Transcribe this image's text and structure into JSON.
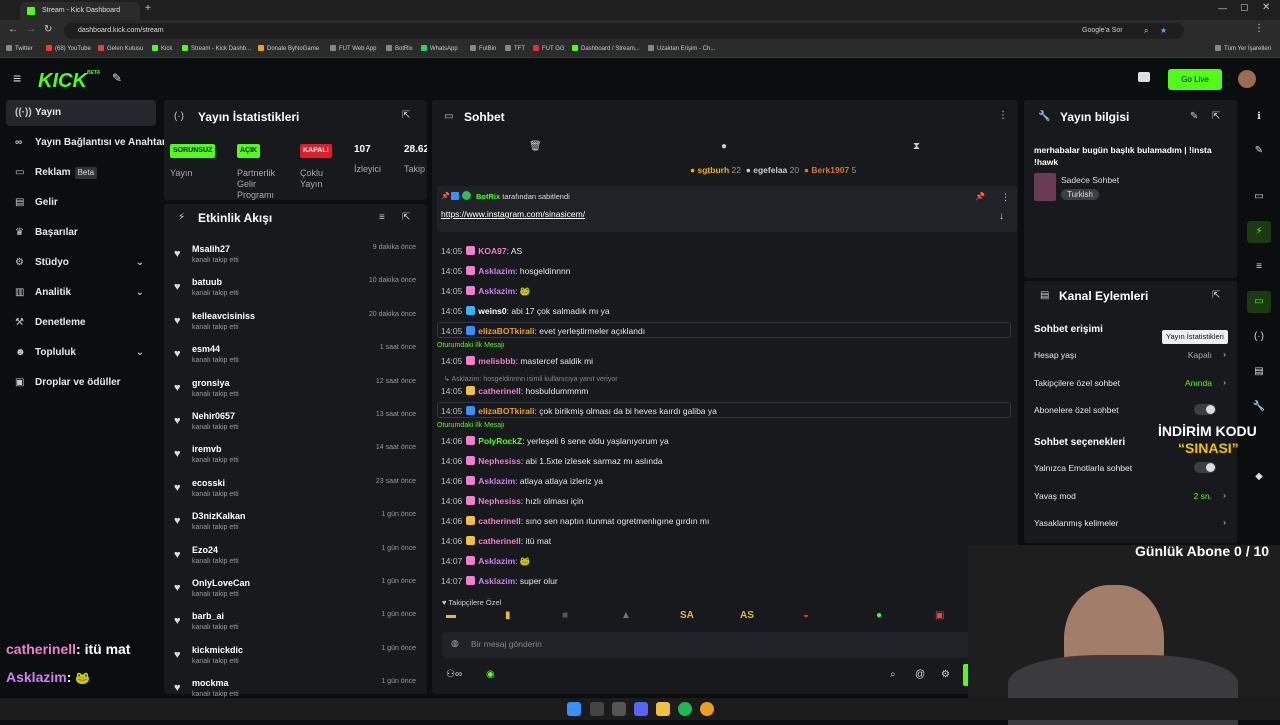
{
  "browser": {
    "tab_title": "Stream - Kick Dashboard",
    "url": "dashboard.kick.com/stream",
    "google_label": "Google'a Sor",
    "bookmarks": [
      "Twitter",
      "(68) YouTube",
      "Gelen Kutusu",
      "Kick",
      "Stream - Kick Dashb...",
      "Donate ByNoGame",
      "FUT Web App",
      "BotRix",
      "WhatsApp",
      "FutBin",
      "TFT",
      "FUT GG",
      "Dashboard / Stream...",
      "Uzaktan Erişim - Ch..."
    ],
    "all_bookmarks": "Tüm Yer İşaretleri"
  },
  "header": {
    "logo": "KICK",
    "logo_sup": "BETA",
    "go_live": "Go Live"
  },
  "nav": {
    "items": [
      {
        "label": "Yayın",
        "icon": "((•))"
      },
      {
        "label": "Yayın Bağlantısı ve Anahtarı",
        "icon": "🔗"
      },
      {
        "label": "Reklam",
        "icon": "▭",
        "badge": "Beta"
      },
      {
        "label": "Gelir",
        "icon": "▭"
      },
      {
        "label": "Başarılar",
        "icon": "🏆"
      },
      {
        "label": "Stüdyo",
        "icon": "⚙"
      },
      {
        "label": "Analitik",
        "icon": "▤"
      },
      {
        "label": "Denetleme",
        "icon": "🔨"
      },
      {
        "label": "Topluluk",
        "icon": "👥"
      },
      {
        "label": "Droplar ve ödüller",
        "icon": "🎁"
      }
    ]
  },
  "stats": {
    "title": "Yayın İstatistikleri",
    "items": [
      {
        "pill": "SORUNSUZ",
        "label": "Yayın"
      },
      {
        "pill": "AÇIK",
        "label": "Partnerlik Gelir Programı"
      },
      {
        "pill": "KAPALI",
        "label": "Çoklu Yayın"
      },
      {
        "num": "107",
        "label": "İzleyici"
      },
      {
        "num": "28.62",
        "label": "Takip"
      }
    ]
  },
  "activity": {
    "title": "Etkinlik Akışı",
    "action": "kanalı takip etti",
    "items": [
      {
        "name": "Msalih27",
        "time": "9 dakika önce"
      },
      {
        "name": "batuub",
        "time": "10 dakika önce"
      },
      {
        "name": "kelleavcisiniss",
        "time": "20 dakika önce"
      },
      {
        "name": "esm44",
        "time": "1 saat önce"
      },
      {
        "name": "gronsiya",
        "time": "12 saat önce"
      },
      {
        "name": "Nehir0657",
        "time": "13 saat önce"
      },
      {
        "name": "iremvb",
        "time": "14 saat önce"
      },
      {
        "name": "ecosski",
        "time": "23 saat önce"
      },
      {
        "name": "D3nizKalkan",
        "time": "1 gün önce"
      },
      {
        "name": "Ezo24",
        "time": "1 gün önce"
      },
      {
        "name": "OnlyLoveCan",
        "time": "1 gün önce"
      },
      {
        "name": "barb_ai",
        "time": "1 gün önce"
      },
      {
        "name": "kickmickdic",
        "time": "1 gün önce"
      },
      {
        "name": "mockma",
        "time": "1 gün önce"
      }
    ]
  },
  "chat": {
    "title": "Sohbet",
    "top_gifters": [
      {
        "name": "sgtburh",
        "count": "22"
      },
      {
        "name": "egefelaa",
        "count": "20"
      },
      {
        "name": "Berk1907",
        "count": "5"
      }
    ],
    "pinned_by": "BotRix",
    "pinned_suffix": "tarafından sabitlendi",
    "pinned_link": "https://www.instagram.com/sinasicem/",
    "first_message_label": "Oturumdaki İlk Mesajı",
    "reply_note": "Asklazim: hosgeldinnnn isimli kullanıcıya yanıt veriyor",
    "messages": [
      {
        "time": "14:05",
        "user": "KOA97",
        "text": "AS",
        "color": "#f07fd0"
      },
      {
        "time": "14:05",
        "user": "Asklazim",
        "text": "hosgeldinnnn",
        "color": "#d07ff0"
      },
      {
        "time": "14:05",
        "user": "Asklazim",
        "text": "🐸",
        "color": "#d07ff0"
      },
      {
        "time": "14:05",
        "user": "weins0",
        "text": "abi 17 çok salmadık mı ya",
        "color": "#ffffff"
      },
      {
        "time": "14:05",
        "user": "elizaBOTkirali",
        "text": "evet yerleştirmeler açıklandı",
        "color": "#f0a020"
      },
      {
        "time": "14:05",
        "user": "melisbbb",
        "text": "mastercef saldik mi",
        "color": "#f07fd0"
      },
      {
        "time": "14:05",
        "user": "catherinell",
        "text": "hosbuldummmm",
        "color": "#f07fd0"
      },
      {
        "time": "14:05",
        "user": "elizaBOTkirali",
        "text": "çok birikmiş olması da bi heves kaırdı galiba ya",
        "color": "#f0a020"
      },
      {
        "time": "14:06",
        "user": "PolyRockZ",
        "text": "yerleşeli 6 sene oldu yaşlanıyorum ya",
        "color": "#53fc18"
      },
      {
        "time": "14:06",
        "user": "Nephesiss",
        "text": "abi 1.5xte izlesek sarmaz mı aslında",
        "color": "#f07fd0"
      },
      {
        "time": "14:06",
        "user": "Asklazim",
        "text": "atlaya atlaya izleriz ya",
        "color": "#d07ff0"
      },
      {
        "time": "14:06",
        "user": "Nephesiss",
        "text": "hızlı olması için",
        "color": "#f07fd0"
      },
      {
        "time": "14:06",
        "user": "catherinell",
        "text": "sıno sen naptın ıtunmat ogretmenlıgıne gırdın mı",
        "color": "#f07fd0"
      },
      {
        "time": "14:06",
        "user": "catherinell",
        "text": "itü mat",
        "color": "#f07fd0"
      },
      {
        "time": "14:07",
        "user": "Asklazim",
        "text": "🐸",
        "color": "#d07ff0"
      },
      {
        "time": "14:07",
        "user": "Asklazim",
        "text": "super olur",
        "color": "#d07ff0"
      }
    ],
    "followers_only": "Takipçilere Özel",
    "emotes": [
      "SA",
      "AS"
    ],
    "input_placeholder": "Bir mesaj gönderin"
  },
  "stream_info": {
    "title": "Yayın bilgisi",
    "stream_title": "merhabalar bugün başlık bulamadım | !insta !hawk",
    "category": "Sadece Sohbet",
    "tag": "Turkish"
  },
  "channel_actions": {
    "title": "Kanal Eylemleri",
    "chat_access": "Sohbet erişimi",
    "tooltip": "Yayın İstatistikleri",
    "rows": [
      {
        "label": "Hesap yaşı",
        "value": "Kapalı",
        "type": "chev"
      },
      {
        "label": "Takipçilere özel sohbet",
        "value": "Anında",
        "type": "chev"
      },
      {
        "label": "Abonelere özel sohbet",
        "type": "toggle"
      }
    ],
    "options_title": "Sohbet seçenekleri",
    "options": [
      {
        "label": "Yalnızca Emotlarla sohbet",
        "type": "toggle"
      },
      {
        "label": "Yavaş mod",
        "value": "2 sn.",
        "type": "chev"
      },
      {
        "label": "Yasaklanmış kelimeler",
        "type": "chev"
      }
    ]
  },
  "overlay": {
    "promo_line1": "İNDİRİM KODU",
    "promo_line2": "“SINASI”",
    "sub_goal": "Günlük Abone 0 / 10",
    "chat1_user": "catherinell",
    "chat1_text": ": itü mat",
    "chat2_user": "Asklazim",
    "chat2_text": ":"
  },
  "colors": {
    "accent": "#53fc18",
    "panel": "#17191c",
    "bg": "#0b0e0f"
  }
}
